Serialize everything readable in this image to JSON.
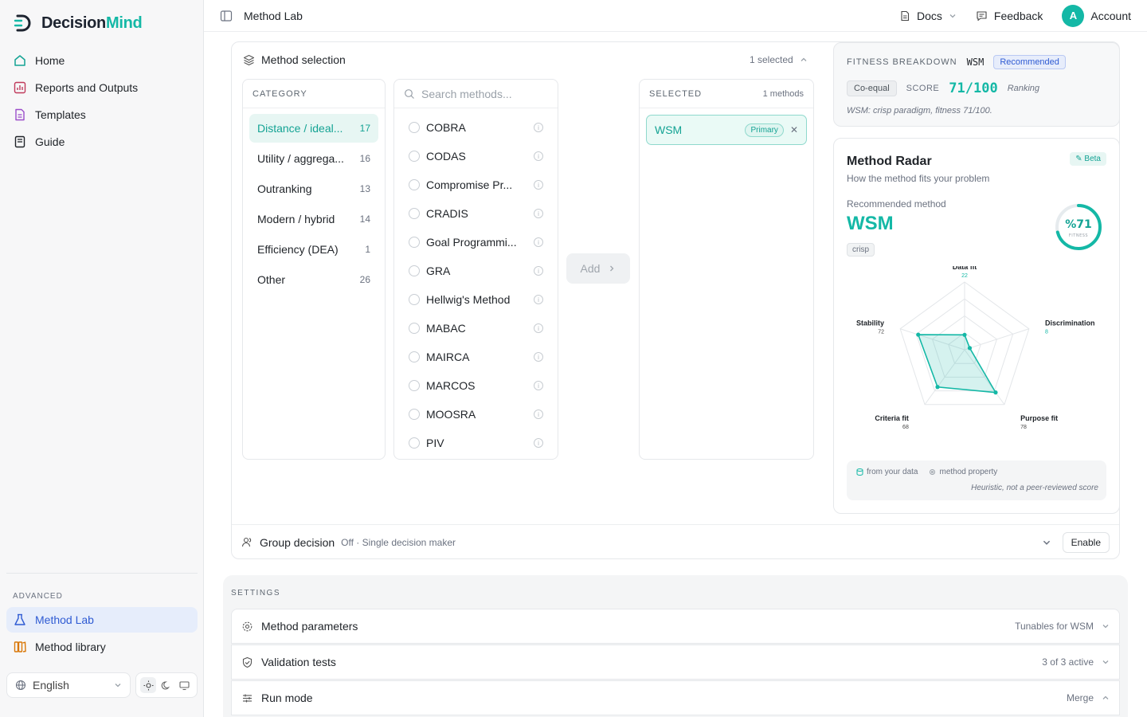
{
  "brand": {
    "part1": "Decision",
    "part2": "Mind"
  },
  "sidebar": {
    "items": [
      {
        "label": "Home",
        "icon": "home-icon"
      },
      {
        "label": "Reports and Outputs",
        "icon": "chart-icon"
      },
      {
        "label": "Templates",
        "icon": "template-icon"
      },
      {
        "label": "Guide",
        "icon": "book-icon"
      }
    ],
    "advanced_label": "ADVANCED",
    "advanced_items": [
      {
        "label": "Method Lab",
        "icon": "flask-icon"
      },
      {
        "label": "Method library",
        "icon": "library-icon"
      }
    ],
    "language": "English"
  },
  "header": {
    "title": "Method Lab",
    "docs": "Docs",
    "feedback": "Feedback",
    "avatar_letter": "A",
    "account": "Account"
  },
  "method_selection": {
    "title": "Method selection",
    "selected_count": "1 selected",
    "category_header": "CATEGORY",
    "categories": [
      {
        "label": "Distance / ideal...",
        "count": "17"
      },
      {
        "label": "Utility / aggrega...",
        "count": "16"
      },
      {
        "label": "Outranking",
        "count": "13"
      },
      {
        "label": "Modern / hybrid",
        "count": "14"
      },
      {
        "label": "Efficiency (DEA)",
        "count": "1"
      },
      {
        "label": "Other",
        "count": "26"
      }
    ],
    "search_placeholder": "Search methods...",
    "methods": [
      "COBRA",
      "CODAS",
      "Compromise Pr...",
      "CRADIS",
      "Goal Programmi...",
      "GRA",
      "Hellwig's Method",
      "MABAC",
      "MAIRCA",
      "MARCOS",
      "MOOSRA",
      "PIV"
    ],
    "add_label": "Add",
    "selected_header": "SELECTED",
    "selected_methods_count": "1 methods",
    "selected_item": {
      "name": "WSM",
      "badge": "Primary"
    }
  },
  "fitness": {
    "label": "FITNESS BREAKDOWN",
    "method": "WSM",
    "badge": "Recommended",
    "tag": "Co-equal",
    "score_label": "SCORE",
    "score": "71/100",
    "mode": "Ranking",
    "note": "WSM: crisp paradigm, fitness 71/100."
  },
  "radar": {
    "title": "Method Radar",
    "subtitle": "How the method fits your problem",
    "beta": "Beta",
    "rec_label": "Recommended method",
    "rec_name": "WSM",
    "rec_tag": "crisp",
    "gauge_value": "%71",
    "gauge_label": "FITNESS",
    "gauge_fraction": 0.71,
    "accent": "#14b8a6",
    "axes": [
      {
        "label": "Data fit",
        "value": 22
      },
      {
        "label": "Discrimination",
        "value": 8
      },
      {
        "label": "Purpose fit",
        "value": 78
      },
      {
        "label": "Criteria fit",
        "value": 68
      },
      {
        "label": "Stability",
        "value": 72
      }
    ],
    "legend_data": "from your data",
    "legend_property": "method property",
    "legend_note": "Heuristic, not a peer-reviewed score"
  },
  "group": {
    "label": "Group decision",
    "status": "Off · Single decision maker",
    "enable": "Enable"
  },
  "settings": {
    "label": "SETTINGS",
    "rows": [
      {
        "name": "Method parameters",
        "value": "Tunables for WSM"
      },
      {
        "name": "Validation tests",
        "value": "3 of 3 active"
      },
      {
        "name": "Run mode",
        "value": "Merge"
      }
    ]
  }
}
